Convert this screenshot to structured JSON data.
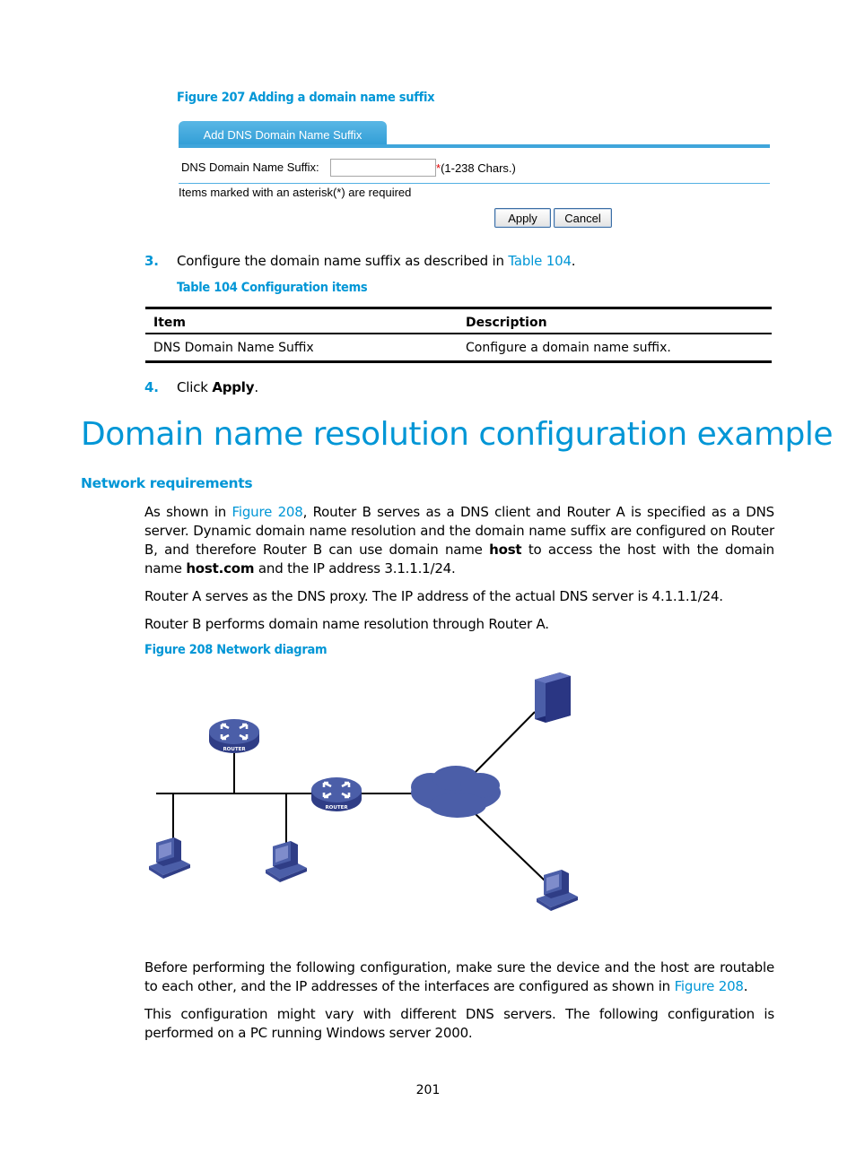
{
  "figure207": {
    "caption": "Figure 207 Adding a domain name suffix",
    "tab_label": "Add DNS Domain Name Suffix",
    "field_label": "DNS Domain Name Suffix:",
    "field_value": "",
    "required_marker": "*",
    "field_hint": "(1-238 Chars.)",
    "required_note": "Items marked with an asterisk(*) are required",
    "apply_label": "Apply",
    "cancel_label": "Cancel"
  },
  "step3": {
    "number": "3.",
    "text_before": "Configure the domain name suffix as described in ",
    "link": "Table 104",
    "text_after": "."
  },
  "table104": {
    "caption": "Table 104 Configuration items",
    "headers": [
      "Item",
      "Description"
    ],
    "rows": [
      [
        "DNS Domain Name Suffix",
        "Configure a domain name suffix."
      ]
    ]
  },
  "step4": {
    "number": "4.",
    "text_before": "Click ",
    "bold": "Apply",
    "text_after": "."
  },
  "section": {
    "title": "Domain name resolution configuration example",
    "subheading": "Network requirements",
    "para1": {
      "t1": "As shown in ",
      "link1": "Figure 208",
      "t2": ", Router B serves as a DNS client and Router A is specified as a DNS server. Dynamic domain name resolution and the domain name suffix are configured on Router B, and therefore Router B can use domain name ",
      "b1": "host",
      "t3": " to access the host with the domain name ",
      "b2": "host.com",
      "t4": " and the IP address 3.1.1.1/24."
    },
    "para2": "Router A serves as the DNS proxy. The IP address of the actual DNS server is 4.1.1.1/24.",
    "para3": "Router B performs domain name resolution through Router A.",
    "figure208_caption": "Figure 208 Network diagram",
    "router_label": "ROUTER",
    "para4": {
      "t1": "Before performing the following configuration, make sure the device and the host are routable to each other, and the IP addresses of the interfaces are configured as shown in ",
      "link1": "Figure 208",
      "t2": "."
    },
    "para5": "This configuration might vary with different DNS servers. The following configuration is performed on a PC running Windows server 2000."
  },
  "footer": {
    "page_number": "201"
  },
  "colors": {
    "accent": "#0096d6",
    "device": "#4b5ea8"
  }
}
